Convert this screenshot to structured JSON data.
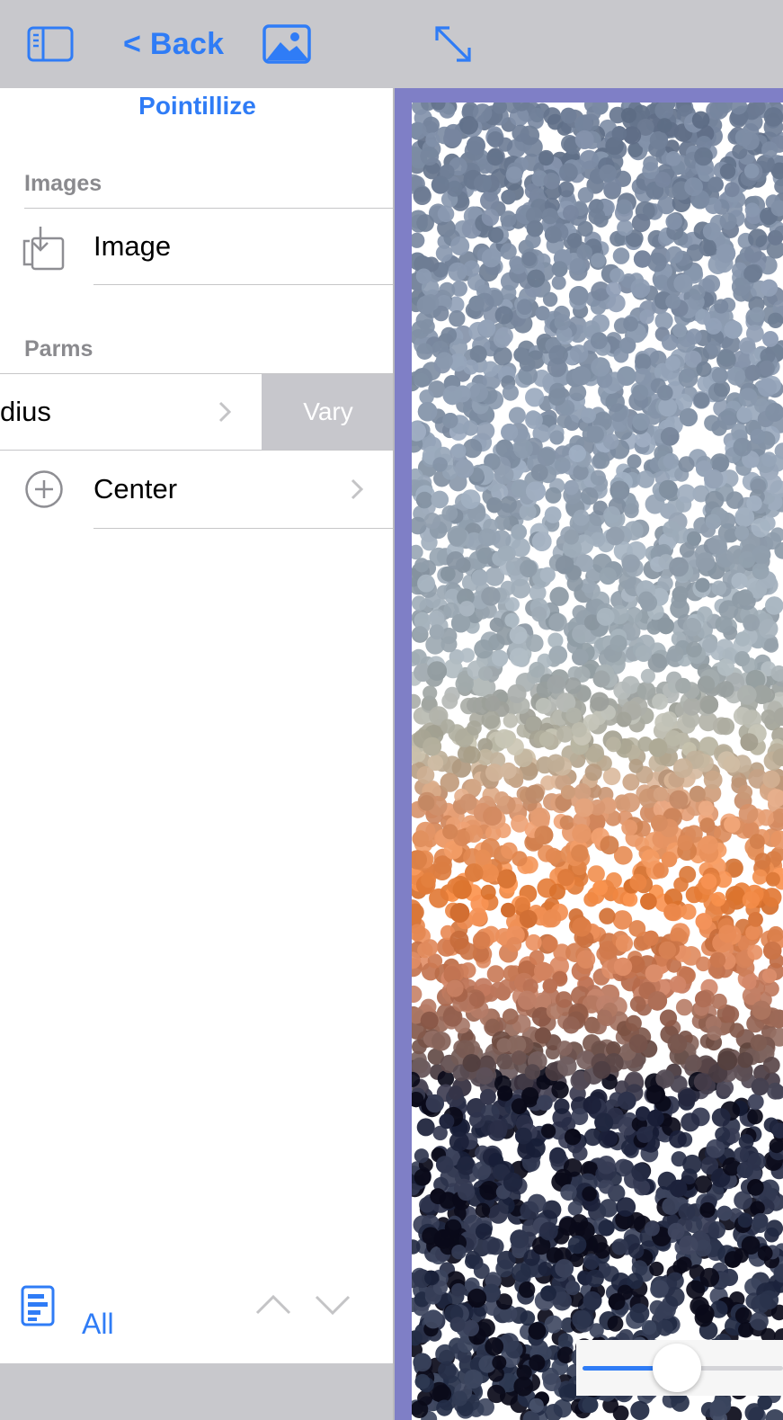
{
  "toolbar": {
    "sidebar_icon": "sidebar-toggle-icon",
    "back_label": "< Back",
    "image_icon": "photo-icon",
    "expand_icon": "expand-arrows-icon",
    "accent_color": "#2f7cf6"
  },
  "panel": {
    "title": "Pointillize",
    "images_header": "Images",
    "image_row_label": "Image",
    "image_row_icon": "image-import-icon",
    "parms_header": "Parms",
    "radius_row_label": "dius",
    "vary_button_label": "Vary",
    "center_row_label": "Center",
    "center_row_icon": "plus-circle-icon",
    "chevron_icon": "chevron-right-icon"
  },
  "bottom": {
    "list_icon": "document-list-icon",
    "all_label": "All",
    "up_icon": "chevron-up-icon",
    "down_icon": "chevron-down-icon"
  },
  "canvas": {
    "frame_color": "#7f7fc6",
    "slider_value": 0.5
  }
}
